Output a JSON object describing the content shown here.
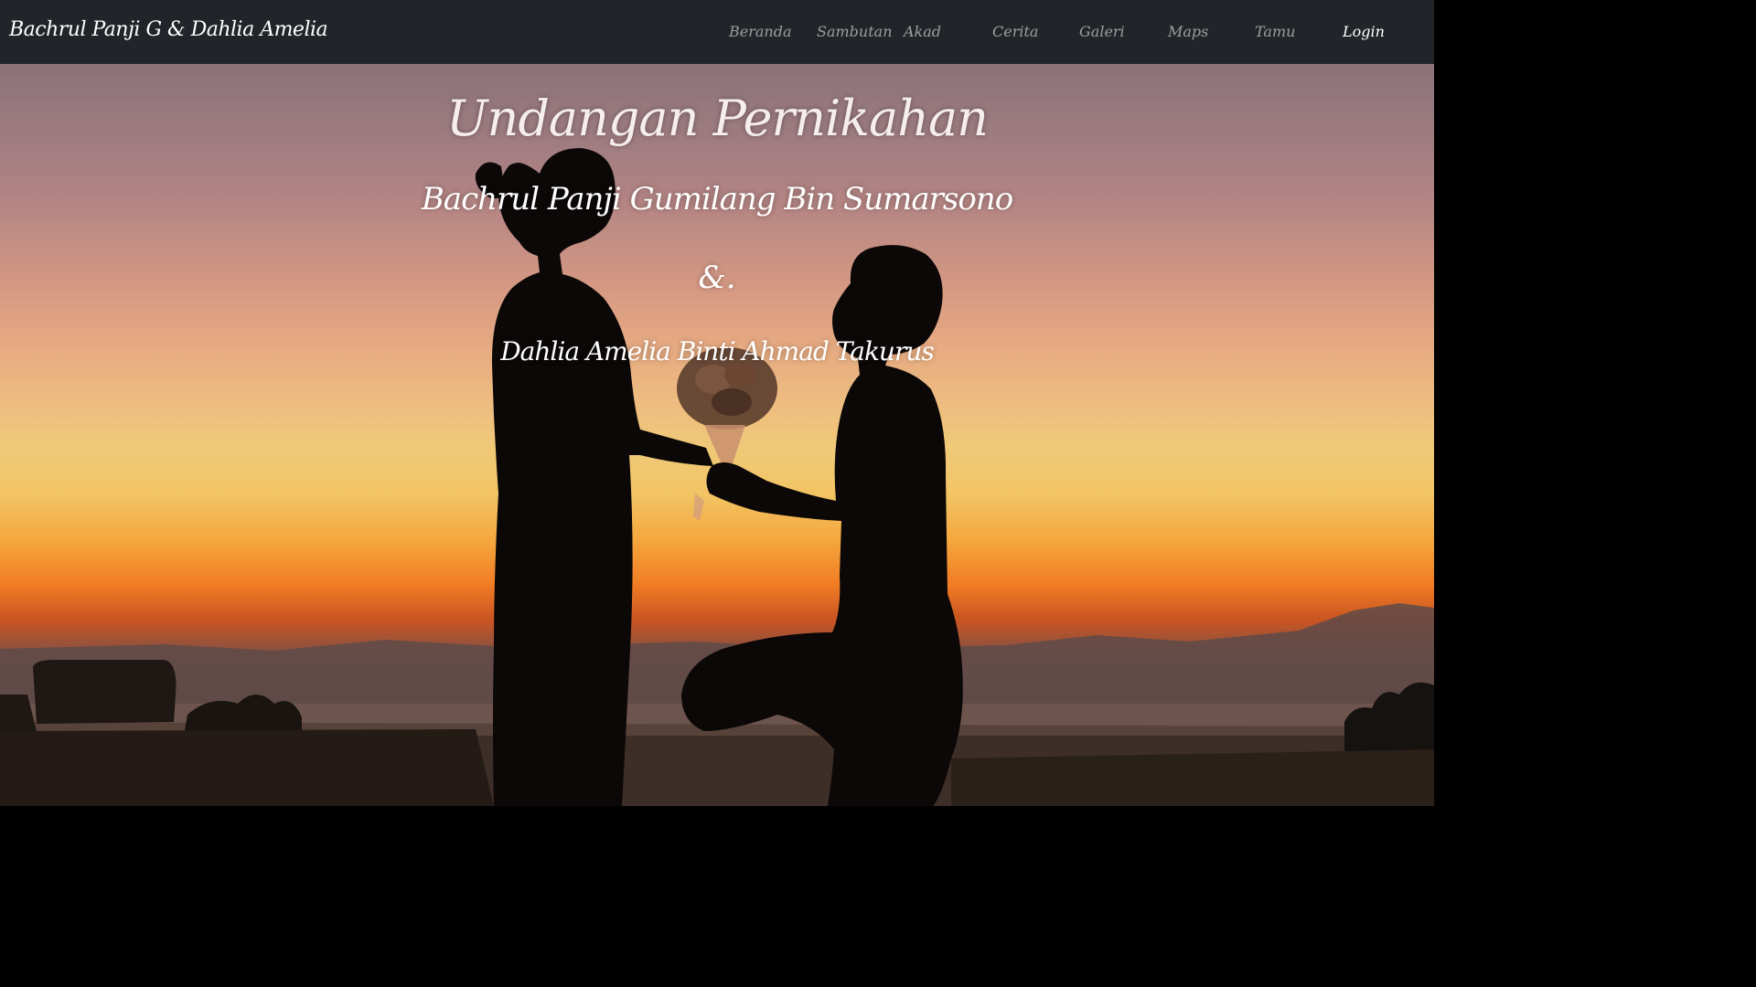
{
  "navbar": {
    "brand": "Bachrul Panji G & Dahlia Amelia",
    "items": [
      {
        "label": "Beranda"
      },
      {
        "label": "Sambutan"
      },
      {
        "label": "Akad"
      },
      {
        "label": "Cerita"
      },
      {
        "label": "Galeri"
      },
      {
        "label": "Maps"
      },
      {
        "label": "Tamu"
      },
      {
        "label": "Login"
      }
    ],
    "active_item": "Login"
  },
  "hero": {
    "title": "Undangan Pernikahan",
    "groom": "Bachrul Panji Gumilang Bin Sumarsono",
    "ampersand": "&.",
    "bride": "Dahlia Amelia Binti Ahmad Takurus",
    "background": "sunset-proposal-silhouette"
  },
  "colors": {
    "navbar_bg": "#212529",
    "nav_link": "#8c8f93",
    "nav_link_active": "#ffffff",
    "hero_text": "#ffffff"
  }
}
